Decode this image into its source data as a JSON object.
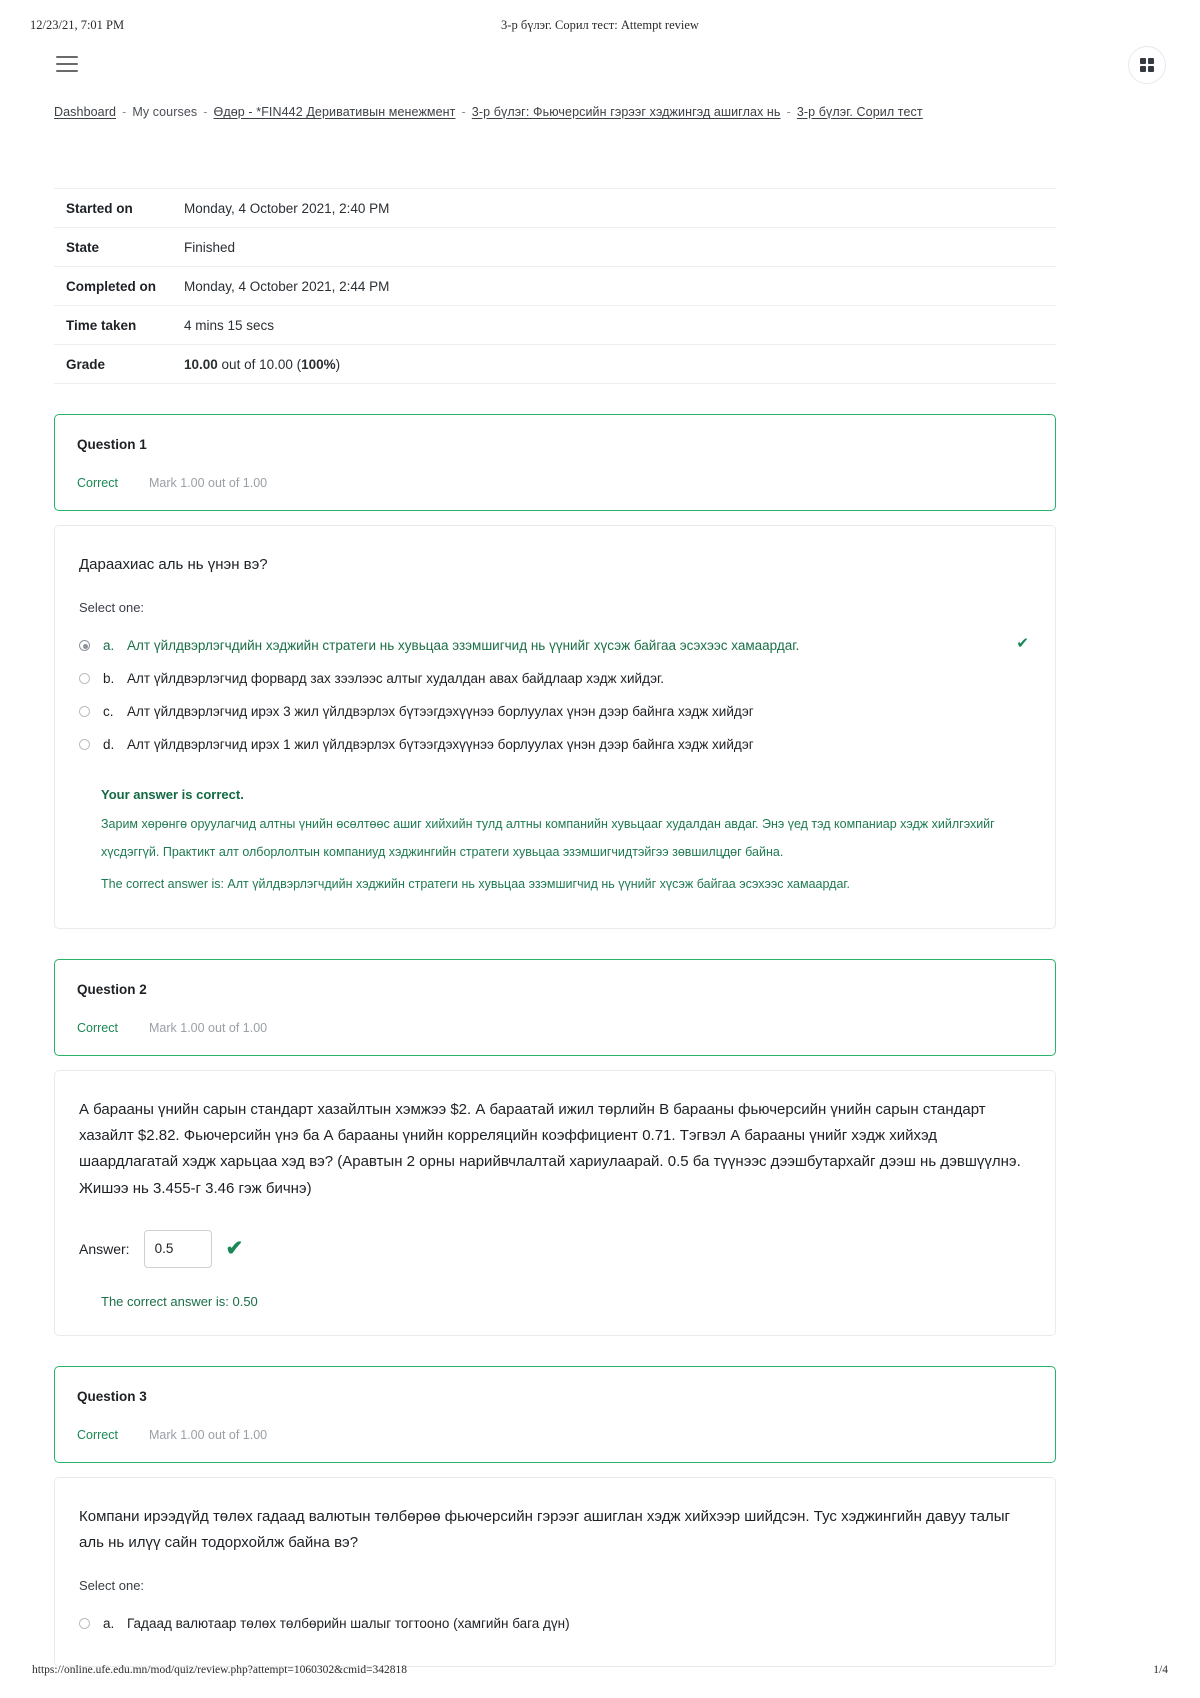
{
  "print": {
    "date": "12/23/21, 7:01 PM",
    "doc_title": "3-р бүлэг. Сорил тест: Attempt review",
    "url": "https://online.ufe.edu.mn/mod/quiz/review.php?attempt=1060302&cmid=342818",
    "page": "1/4"
  },
  "navbar": {
    "menu_icon": "hamburger-icon",
    "grid_icon": "grid-icon"
  },
  "breadcrumb": {
    "items": [
      {
        "label": "Dashboard",
        "link": true
      },
      {
        "label": "My courses",
        "link": false
      },
      {
        "label": "Өдөр - *FIN442 Деривативын менежмент",
        "link": true
      },
      {
        "label": "3-р бүлэг: Фьючерсийн гэрээг хэджингэд ашиглах нь",
        "link": true
      },
      {
        "label": "3-р бүлэг. Сорил тест",
        "link": true
      }
    ],
    "separator": "-"
  },
  "summary": {
    "rows": [
      {
        "label": "Started on",
        "value": "Monday, 4 October 2021, 2:40 PM"
      },
      {
        "label": "State",
        "value": "Finished"
      },
      {
        "label": "Completed on",
        "value": "Monday, 4 October 2021, 2:44 PM"
      },
      {
        "label": "Time taken",
        "value": "4 mins 15 secs"
      }
    ],
    "grade": {
      "label": "Grade",
      "score": "10.00",
      "mid": " out of 10.00 (",
      "percent": "100%",
      "close": ")"
    }
  },
  "questions": [
    {
      "number": "Question 1",
      "state": "Correct",
      "mark": "Mark 1.00 out of 1.00",
      "stem": "Дараахиас аль нь үнэн вэ?",
      "select_one": "Select one:",
      "options": [
        {
          "letter": "a.",
          "text": "Алт үйлдвэрлэгчдийн хэджийн стратеги нь хувьцаа эзэмшигчид нь үүнийг хүсэж байгаа эсэхээс хамаардаг.",
          "chosen": true,
          "correct": true,
          "tick": "✔"
        },
        {
          "letter": "b.",
          "text": "Алт үйлдвэрлэгчид форвард зах зээлээс алтыг худалдан авах байдлаар хэдж хийдэг.",
          "chosen": false,
          "correct": false,
          "tick": ""
        },
        {
          "letter": "c.",
          "text": "Алт үйлдвэрлэгчид ирэх 3 жил үйлдвэрлэх бүтээгдэхүүнээ борлуулах үнэн дээр байнга хэдж хийдэг",
          "chosen": false,
          "correct": false,
          "tick": ""
        },
        {
          "letter": "d.",
          "text": "Алт үйлдвэрлэгчид ирэх 1 жил үйлдвэрлэх бүтээгдэхүүнээ борлуулах үнэн дээр байнга хэдж хийдэг",
          "chosen": false,
          "correct": false,
          "tick": ""
        }
      ],
      "feedback": {
        "title": "Your answer is correct.",
        "body_line1": "Зарим хөрөнгө оруулагчид алтны үнийн өсөлтөөс ашиг хийхийн тулд алтны компанийн хувьцааг худалдан авдаг. Энэ үед тэд компаниар хэдж хийлгэхийг",
        "body_line2": "хүсдэггүй. Практикт алт олборлолтын компаниуд хэджингийн стратеги хувьцаа эзэмшигчидтэйгээ зөвшилцдөг байна.",
        "correct_answer": "The correct answer is: Алт үйлдвэрлэгчдийн хэджийн стратеги нь хувьцаа эзэмшигчид нь үүнийг хүсэж байгаа эсэхээс хамаардаг."
      }
    },
    {
      "number": "Question 2",
      "state": "Correct",
      "mark": "Mark 1.00 out of 1.00",
      "stem": "А барааны үнийн сарын стандарт хазайлтын хэмжээ $2. А бараатай ижил төрлийн В барааны фьючерсийн үнийн сарын стандарт хазайлт $2.82. Фьючерсийн үнэ ба  А барааны үнийн корреляцийн коэффициент 0.71. Тэгвэл А барааны үнийг хэдж хийхэд шаардлагатай хэдж харьцаа хэд вэ? (Аравтын 2 орны нарийвчлалтай хариулаарай. 0.5 ба түүнээс дээшбутархайг дээш нь дэвшүүлнэ. Жишээ нь 3.455-г 3.46 гэж бичнэ)",
      "answer_label": "Answer:",
      "answer_value": "0.5",
      "answer_tick": "✔",
      "correct_line": "The correct answer is: 0.50"
    },
    {
      "number": "Question 3",
      "state": "Correct",
      "mark": "Mark 1.00 out of 1.00",
      "stem": "Компани ирээдүйд төлөх гадаад валютын төлбөрөө фьючерсийн гэрээг ашиглан хэдж хийхээр шийдсэн. Тус хэджингийн давуу талыг аль нь илүү сайн тодорхойлж байна вэ?",
      "select_one": "Select one:",
      "options": [
        {
          "letter": "a.",
          "text": "Гадаад валютаар төлөх төлбөрийн шалыг тогтооно (хамгийн бага дүн)",
          "chosen": false,
          "correct": false,
          "tick": ""
        }
      ]
    }
  ],
  "colors": {
    "green_border": "#28b36b",
    "green_text": "#1a8754",
    "feedback_green": "#1f7a52",
    "muted": "#9aa0a6"
  }
}
